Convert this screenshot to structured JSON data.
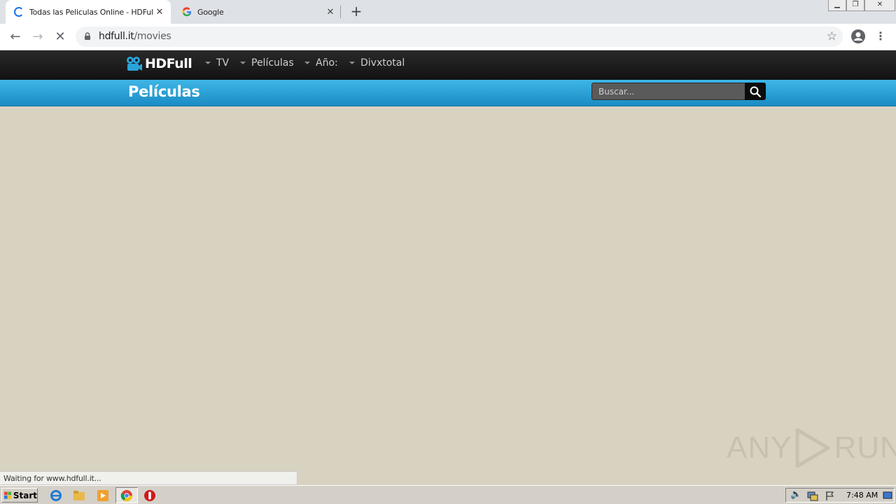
{
  "browser": {
    "tabs": [
      {
        "title": "Todas las Peliculas Online - HDFull.tv",
        "active": true,
        "loading": true
      },
      {
        "title": "Google",
        "active": false,
        "icon": "google-g-icon"
      }
    ],
    "new_tab_label": "+",
    "url_host": "hdfull.it",
    "url_path": "/movies",
    "status_text": "Waiting for www.hdfull.it..."
  },
  "site": {
    "logo_text": "HDFull",
    "nav": [
      {
        "label": "TV"
      },
      {
        "label": "Películas"
      },
      {
        "label": "Año:"
      },
      {
        "label": "Divxtotal"
      }
    ],
    "page_title": "Películas",
    "search_placeholder": "Buscar..."
  },
  "watermark": {
    "left": "ANY",
    "right": "RUN"
  },
  "taskbar": {
    "start_label": "Start",
    "clock": "7:48 AM"
  },
  "colors": {
    "site_bar": "#2aa3d8",
    "site_nav": "#1a1a1a",
    "content_bg": "#d8d2c0"
  }
}
